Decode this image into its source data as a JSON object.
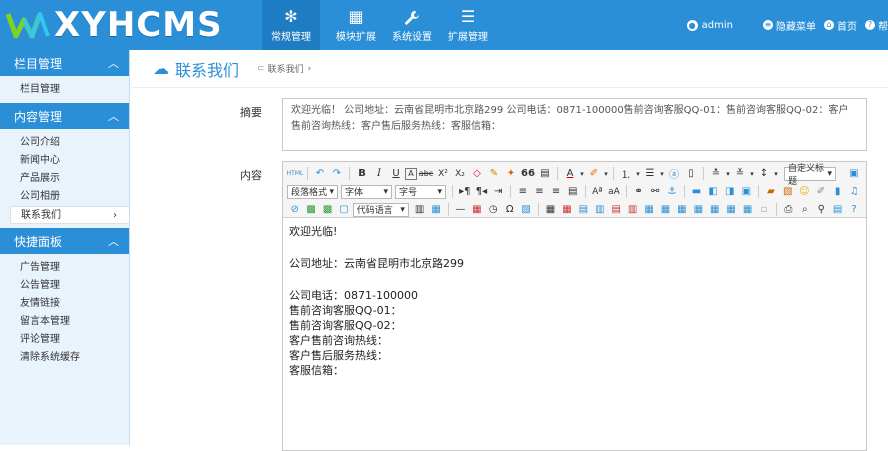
{
  "brand": {
    "logo_text": "XYHCMS"
  },
  "topnav": [
    {
      "label": "常规管理",
      "icon": "snowflake-icon",
      "glyph": "✻",
      "active": true
    },
    {
      "label": "模块扩展",
      "icon": "grid-icon",
      "glyph": "▦",
      "active": false
    },
    {
      "label": "系统设置",
      "icon": "wrench-icon",
      "glyph": "🔧",
      "active": false
    },
    {
      "label": "扩展管理",
      "icon": "list-icon",
      "glyph": "☰",
      "active": false
    }
  ],
  "topright": {
    "user": "admin",
    "hide_menu": "隐藏菜单",
    "home": "首页",
    "help": "帮"
  },
  "sidebar": {
    "section1": {
      "title": "栏目管理",
      "items": [
        "栏目管理"
      ]
    },
    "section2": {
      "title": "内容管理",
      "items": [
        "公司介绍",
        "新闻中心",
        "产品展示",
        "公司相册",
        "联系我们"
      ]
    },
    "section3": {
      "title": "快捷面板",
      "items": [
        "广告管理",
        "公告管理",
        "友情链接",
        "留言本管理",
        "评论管理",
        "清除系统缓存"
      ]
    }
  },
  "main": {
    "title": "联系我们",
    "breadcrumb": "联系我们",
    "summary_label": "摘要",
    "summary_text": "欢迎光临！ 公司地址：云南省昆明市北京路299 公司电话：0871-100000售前咨询客服QQ-01：售前咨询客服QQ-02：客户售前咨询热线：客户售后服务热线：客服信箱：",
    "content_label": "内容"
  },
  "editor": {
    "toolbar": {
      "custom_title": "自定义标题",
      "paragraph": "段落格式",
      "font": "字体",
      "size": "字号",
      "code_lang": "代码语言"
    },
    "lines": [
      "欢迎光临!",
      "公司地址：云南省昆明市北京路299",
      "公司电话：0871-100000",
      "售前咨询客服QQ-01：",
      "售前咨询客服QQ-02：",
      "客户售前咨询热线：",
      "客户售后服务热线：",
      "客服信箱："
    ]
  },
  "colors": {
    "accent": "#2b8fd8",
    "accent_dark": "#1e7cc3",
    "sidebar_bg": "#e9f3fb"
  }
}
